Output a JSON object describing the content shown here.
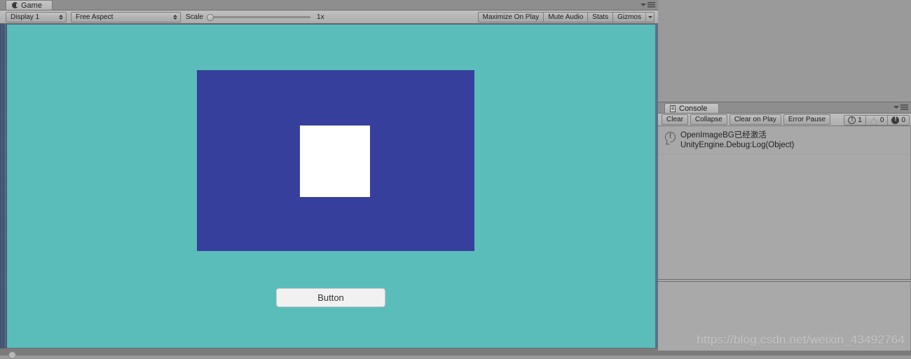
{
  "game_panel": {
    "tab": {
      "label": "Game",
      "icon": "game-controller-icon"
    },
    "panel_menu_icon": "panel-options-menu-icon",
    "toolbar": {
      "display_popup": {
        "value": "Display 1"
      },
      "aspect_popup": {
        "value": "Free Aspect"
      },
      "scale": {
        "label": "Scale",
        "value": "1x",
        "slider_position_pct": 0
      },
      "maximize_on_play": "Maximize On Play",
      "mute_audio": "Mute Audio",
      "stats": "Stats",
      "gizmos": "Gizmos",
      "gizmos_dropdown_icon": "chevron-down-icon"
    },
    "view": {
      "background_color": "#5bbdba",
      "blue_panel_color": "#373f9c",
      "white_square_color": "#ffffff",
      "button_label": "Button"
    },
    "status_bar": {
      "text": ""
    }
  },
  "console_panel": {
    "tab": {
      "label": "Console",
      "icon": "console-list-icon"
    },
    "panel_menu_icon": "panel-options-menu-icon",
    "toolbar": {
      "clear": "Clear",
      "collapse": "Collapse",
      "clear_on_play": "Clear on Play",
      "error_pause": "Error Pause",
      "counters": {
        "info": "1",
        "warning": "0",
        "error": "0"
      }
    },
    "log_entries": [
      {
        "icon": "info-log-icon",
        "message": "OpenImageBG已经激活",
        "stack": "UnityEngine.Debug:Log(Object)"
      }
    ],
    "detail_pane_text": ""
  },
  "watermark": {
    "text": "https://blog.csdn.net/weixin_43492764"
  }
}
